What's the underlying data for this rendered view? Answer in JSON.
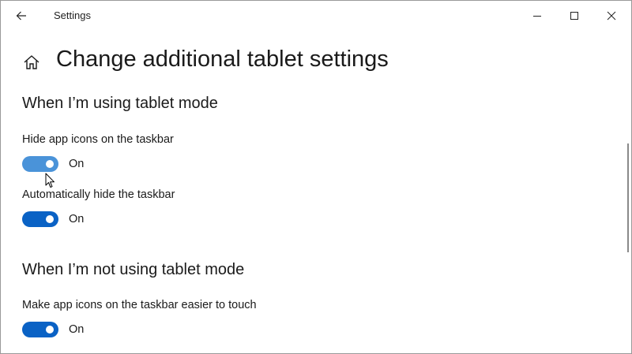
{
  "window": {
    "title": "Settings",
    "back_icon": "arrow-left-icon",
    "minimize_icon": "minimize-icon",
    "maximize_icon": "maximize-icon",
    "close_icon": "close-icon"
  },
  "header": {
    "icon": "home-icon",
    "title": "Change additional tablet settings"
  },
  "sections": [
    {
      "title": "When I’m using tablet mode",
      "settings": [
        {
          "label": "Hide app icons on the taskbar",
          "state": "On",
          "checked": true
        },
        {
          "label": "Automatically hide the taskbar",
          "state": "On",
          "checked": true
        }
      ]
    },
    {
      "title": "When I’m not using tablet mode",
      "settings": [
        {
          "label": "Make app icons on the taskbar easier to touch",
          "state": "On",
          "checked": true
        }
      ]
    }
  ],
  "colors": {
    "accent": "#0a62c5",
    "accent_hover": "#4a93d9",
    "text": "#1a1a1a"
  }
}
